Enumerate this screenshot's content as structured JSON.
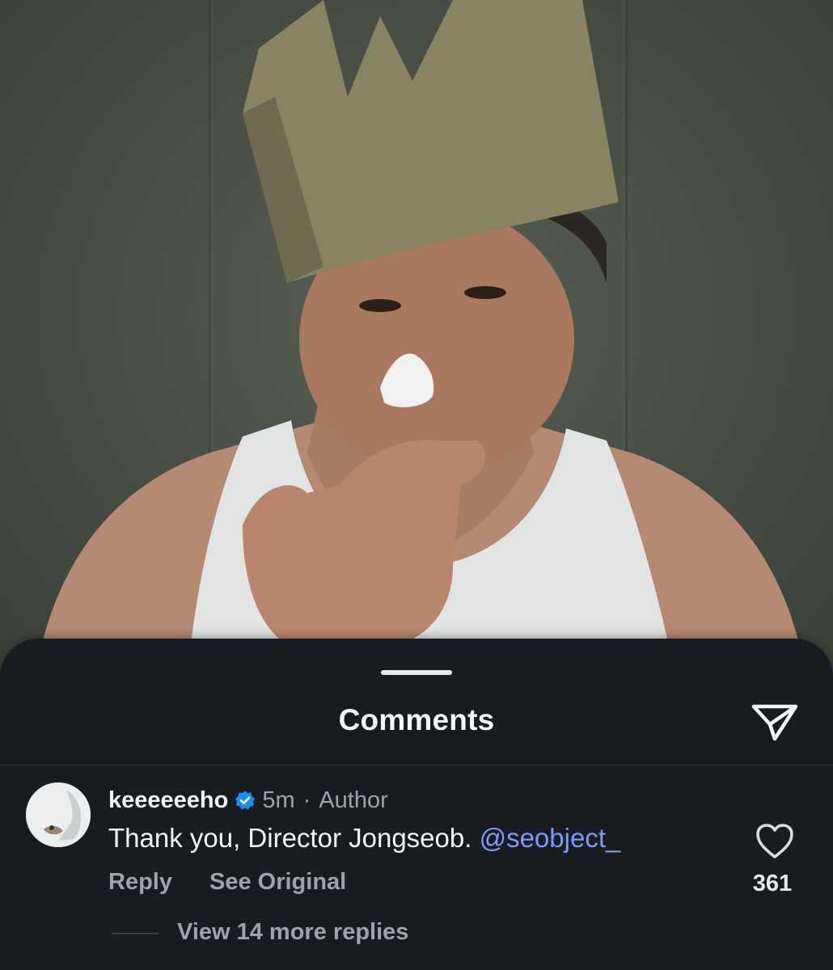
{
  "sheet": {
    "title": "Comments"
  },
  "comment": {
    "username": "keeeeeeho",
    "timestamp": "5m",
    "separator": "·",
    "author_tag": "Author",
    "text": "Thank you, Director Jongseob.",
    "mention": "@seobject_",
    "reply_label": "Reply",
    "see_original_label": "See Original",
    "like_count": "361",
    "view_replies_label": "View 14 more replies"
  },
  "icons": {
    "share": "send-icon",
    "like": "heart-outline-icon",
    "verified": "verified-badge-icon"
  },
  "colors": {
    "sheet_background": "#181b1f",
    "primary_text": "#f4f5f6",
    "secondary_text": "#9ea3a9",
    "mention": "#7d9bf5",
    "verified_badge": "#1d8cf0"
  }
}
